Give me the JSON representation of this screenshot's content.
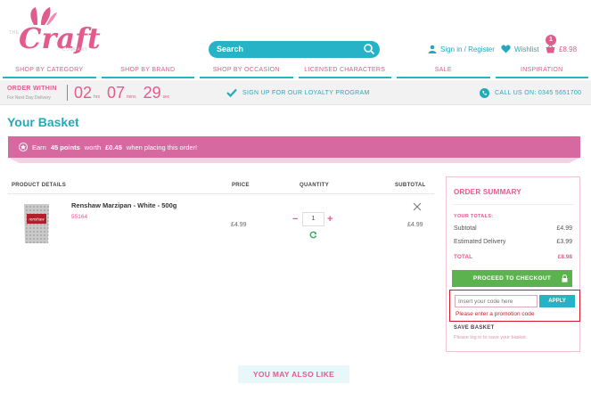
{
  "header": {
    "logo": {
      "the": "THE",
      "word": "Craft",
      "company": "COMPANY"
    },
    "search": {
      "placeholder": "Search"
    },
    "signin_label": "Sign in / Register",
    "wishlist_label": "Wishlist",
    "cart_total": "£8.98",
    "cart_count": "1"
  },
  "nav": {
    "items": [
      {
        "label": "SHOP BY CATEGORY"
      },
      {
        "label": "SHOP BY BRAND"
      },
      {
        "label": "SHOP BY OCCASION"
      },
      {
        "label": "LICENSED CHARACTERS"
      },
      {
        "label": "SALE"
      },
      {
        "label": "INSPIRATION"
      }
    ]
  },
  "promo_bar": {
    "order_within": "ORDER WITHIN",
    "order_within_sub": "For Next Day Delivery",
    "timer": {
      "hours": "02",
      "hours_unit": "hrs",
      "mins": "07",
      "mins_unit": "mins",
      "secs": "29",
      "secs_unit": "sec"
    },
    "loyalty": "SIGN UP FOR OUR LOYALTY PROGRAM",
    "call_us": "CALL US ON: 0345 5651700"
  },
  "page": {
    "title": "Your Basket",
    "points_pre": "Earn",
    "points_bold1": "45 points",
    "points_mid": "worth",
    "points_bold2": "£0.45",
    "points_post": "when placing this order!"
  },
  "basket": {
    "columns": {
      "product": "PRODUCT DETAILS",
      "price": "PRICE",
      "quantity": "QUANTITY",
      "subtotal": "SUBTOTAL"
    },
    "items": [
      {
        "name": "Renshaw Marzipan - White - 500g",
        "code": "55164",
        "price": "£4.99",
        "quantity": "1",
        "subtotal": "£4.99",
        "image_label": "renshaw"
      }
    ]
  },
  "summary": {
    "title": "ORDER SUMMARY",
    "totals_label": "YOUR TOTALS:",
    "subtotal_label": "Subtotal",
    "subtotal_value": "£4.99",
    "delivery_label": "Estimated Delivery",
    "delivery_value": "£3.99",
    "total_label": "TOTAL",
    "total_value": "£8.98",
    "checkout_label": "PROCEED TO CHECKOUT",
    "promo_placeholder": "Insert your code here",
    "apply_label": "APPLY",
    "promo_error": "Please enter a promotion code",
    "save_basket": "SAVE BASKET",
    "save_hint": "Please log in to save your basket."
  },
  "also_like": "YOU MAY ALSO LIKE",
  "colors": {
    "pink": "#e25b8d",
    "teal": "#26b3c7",
    "green": "#5cb24e",
    "error": "#d11a2a"
  }
}
